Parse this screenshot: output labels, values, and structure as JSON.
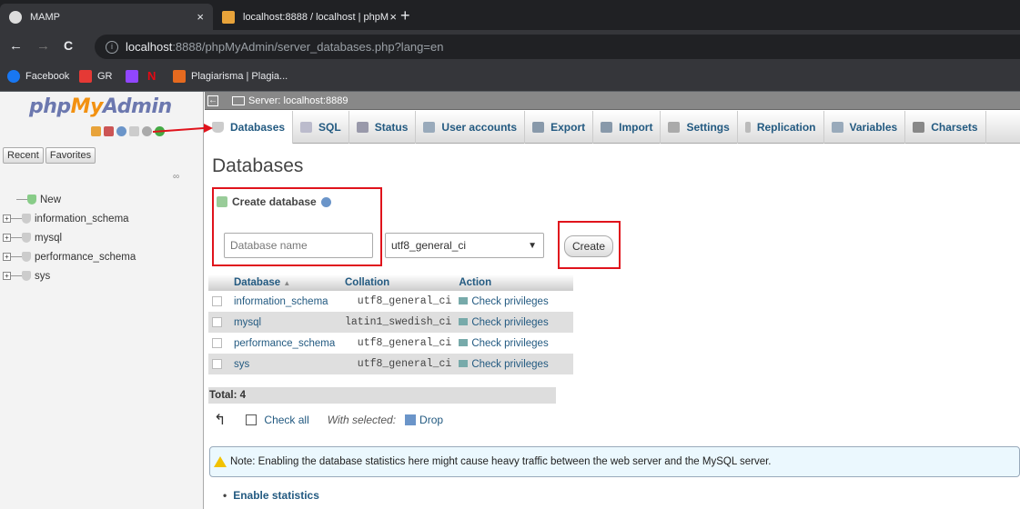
{
  "browser": {
    "tabs": [
      {
        "label": "MAMP",
        "close": "×"
      },
      {
        "label": "localhost:8888 / localhost | phpM",
        "close": "×"
      }
    ],
    "new_tab": "+",
    "nav": {
      "back": "←",
      "forward": "→",
      "reload": "C"
    },
    "url_host": "localhost",
    "url_rest": ":8888/phpMyAdmin/server_databases.php?lang=en",
    "bookmarks": [
      "Facebook",
      "GR",
      "",
      "",
      "Plagiarisma | Plagia..."
    ]
  },
  "sidebar": {
    "logo_php": "php",
    "logo_my": "My",
    "logo_admin": "Admin",
    "recent_label": "Recent",
    "favorites_label": "Favorites",
    "tree": [
      {
        "label": "New",
        "expandable": false
      },
      {
        "label": "information_schema",
        "expandable": true
      },
      {
        "label": "mysql",
        "expandable": true
      },
      {
        "label": "performance_schema",
        "expandable": true
      },
      {
        "label": "sys",
        "expandable": true
      }
    ]
  },
  "main": {
    "server_label": "Server: localhost:8889",
    "tabs": [
      "Databases",
      "SQL",
      "Status",
      "User accounts",
      "Export",
      "Import",
      "Settings",
      "Replication",
      "Variables",
      "Charsets"
    ],
    "page_title": "Databases",
    "create_title": "Create database",
    "db_name_placeholder": "Database name",
    "collation_value": "utf8_general_ci",
    "create_button": "Create",
    "table": {
      "headers": [
        "Database",
        "Collation",
        "Action"
      ],
      "sort_indicator": "▲",
      "rows": [
        {
          "db": "information_schema",
          "collation": "utf8_general_ci",
          "action": "Check privileges"
        },
        {
          "db": "mysql",
          "collation": "latin1_swedish_ci",
          "action": "Check privileges"
        },
        {
          "db": "performance_schema",
          "collation": "utf8_general_ci",
          "action": "Check privileges"
        },
        {
          "db": "sys",
          "collation": "utf8_general_ci",
          "action": "Check privileges"
        }
      ],
      "total": "Total: 4"
    },
    "check_all": "Check all",
    "with_selected": "With selected:",
    "drop": "Drop",
    "note": "Note: Enabling the database statistics here might cause heavy traffic between the web server and the MySQL server.",
    "enable_stats": "Enable statistics"
  },
  "colors": {
    "highlight_red": "#e0131c",
    "link_blue": "#235a81"
  }
}
